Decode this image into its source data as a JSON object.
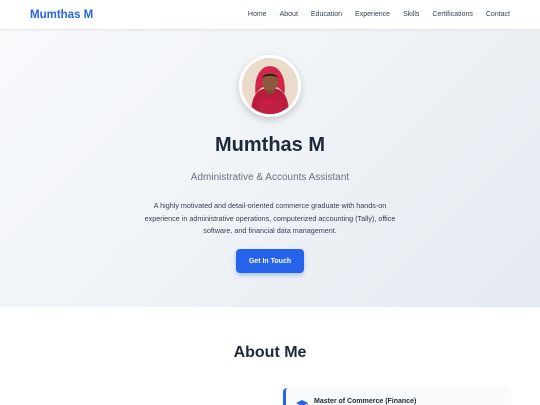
{
  "navbar": {
    "brand": "Mumthas M",
    "links": [
      "Home",
      "About",
      "Education",
      "Experience",
      "Skills",
      "Certifications",
      "Contact"
    ]
  },
  "hero": {
    "name": "Mumthas M",
    "role": "Administrative & Accounts Assistant",
    "description": "A highly motivated and detail-oriented commerce graduate with hands-on experience in administrative operations, computerized accounting (Tally), office software, and financial data management.",
    "cta_label": "Get In Touch"
  },
  "about": {
    "title": "About Me",
    "education_card": {
      "icon": "graduation-cap-icon",
      "degree": "Master of Commerce (Finance)"
    }
  },
  "colors": {
    "accent": "#2563eb",
    "text": "#1f2937",
    "muted": "#6b7280"
  }
}
